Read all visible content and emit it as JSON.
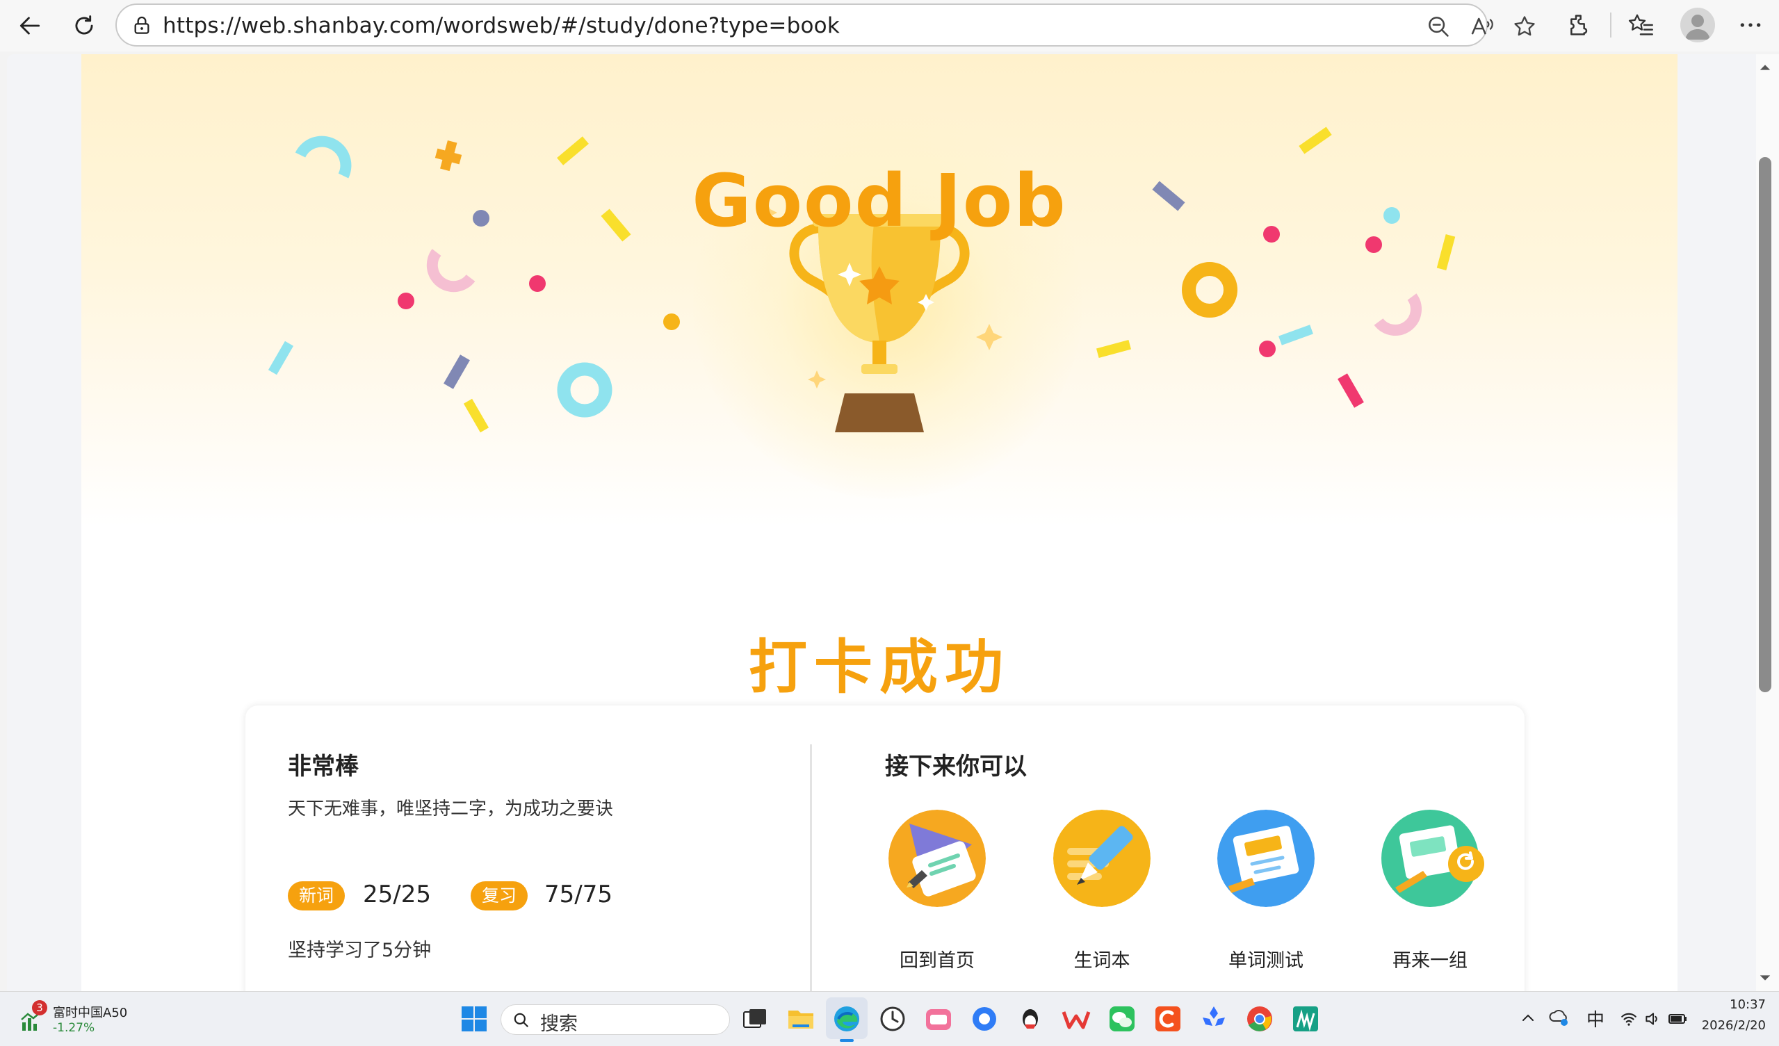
{
  "browser": {
    "url": "https://web.shanbay.com/wordsweb/#/study/done?type=book"
  },
  "hero": {
    "headline": "Good Job",
    "checkin_text": "打卡成功"
  },
  "summary": {
    "title": "非常棒",
    "quote": "天下无难事，唯坚持二字，为成功之要诀",
    "new_words_tag": "新词",
    "new_words_value": "25/25",
    "review_tag": "复习",
    "review_value": "75/75",
    "duration": "坚持学习了5分钟"
  },
  "next": {
    "title": "接下来你可以",
    "actions": [
      {
        "label": "回到首页"
      },
      {
        "label": "生词本"
      },
      {
        "label": "单词测试"
      },
      {
        "label": "再来一组"
      }
    ]
  },
  "taskbar": {
    "widget_name": "富时中国A50",
    "widget_value": "-1.27%",
    "widget_badge": "3",
    "search_label": "搜索",
    "ime": "中",
    "time": "10:37",
    "date": "2026/2/20"
  },
  "colors": {
    "accent": "#f6a10e",
    "hero_bg": "#fff1cc",
    "widget_down": "#2a8a3a"
  }
}
